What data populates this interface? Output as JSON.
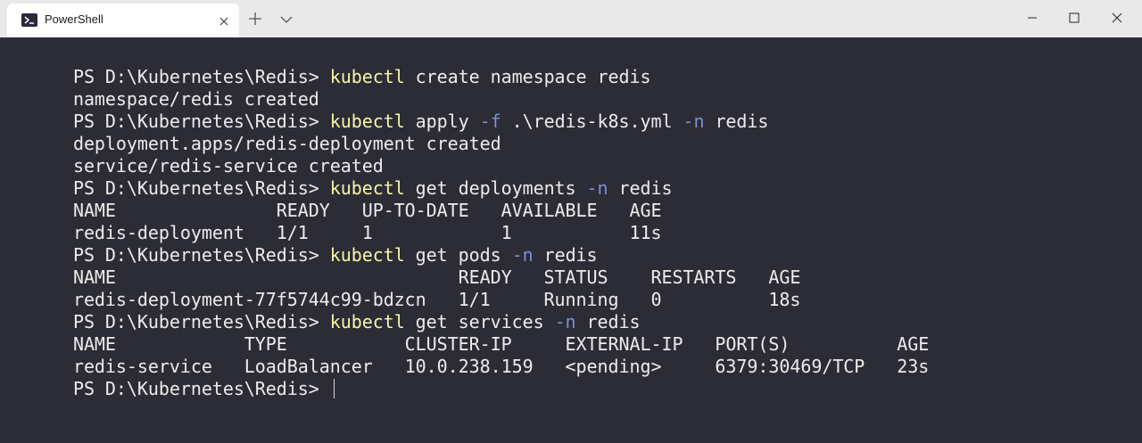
{
  "window": {
    "tab_title": "PowerShell",
    "icons": {
      "tab": "powershell-icon",
      "tab_close": "close-icon",
      "new_tab": "plus-icon",
      "dropdown": "chevron-down-icon",
      "minimize": "minimize-icon",
      "maximize": "maximize-icon",
      "close": "close-icon"
    }
  },
  "terminal": {
    "colors": {
      "background": "#2c2c36",
      "text": "#ececec",
      "command": "#f6f6a8",
      "parameter": "#7b8fd4"
    },
    "lines": [
      [
        "PS D:\\Kubernetes\\Redis> ",
        "kubectl",
        " create namespace redis"
      ],
      [
        "namespace/redis created"
      ],
      [
        "PS D:\\Kubernetes\\Redis> ",
        "kubectl",
        " apply ",
        "-f",
        " .\\redis-k8s.yml ",
        "-n",
        " redis"
      ],
      [
        "deployment.apps/redis-deployment created"
      ],
      [
        "service/redis-service created"
      ],
      [
        "PS D:\\Kubernetes\\Redis> ",
        "kubectl",
        " get deployments ",
        "-n",
        " redis"
      ],
      [
        "NAME               READY   UP-TO-DATE   AVAILABLE   AGE"
      ],
      [
        "redis-deployment   1/1     1            1           11s"
      ],
      [
        "PS D:\\Kubernetes\\Redis> ",
        "kubectl",
        " get pods ",
        "-n",
        " redis"
      ],
      [
        "NAME                                READY   STATUS    RESTARTS   AGE"
      ],
      [
        "redis-deployment-77f5744c99-bdzcn   1/1     Running   0          18s"
      ],
      [
        "PS D:\\Kubernetes\\Redis> ",
        "kubectl",
        " get services ",
        "-n",
        " redis"
      ],
      [
        "NAME            TYPE           CLUSTER-IP     EXTERNAL-IP   PORT(S)          AGE"
      ],
      [
        "redis-service   LoadBalancer   10.0.238.159   <pending>     6379:30469/TCP   23s"
      ],
      [
        "PS D:\\Kubernetes\\Redis> "
      ]
    ]
  }
}
